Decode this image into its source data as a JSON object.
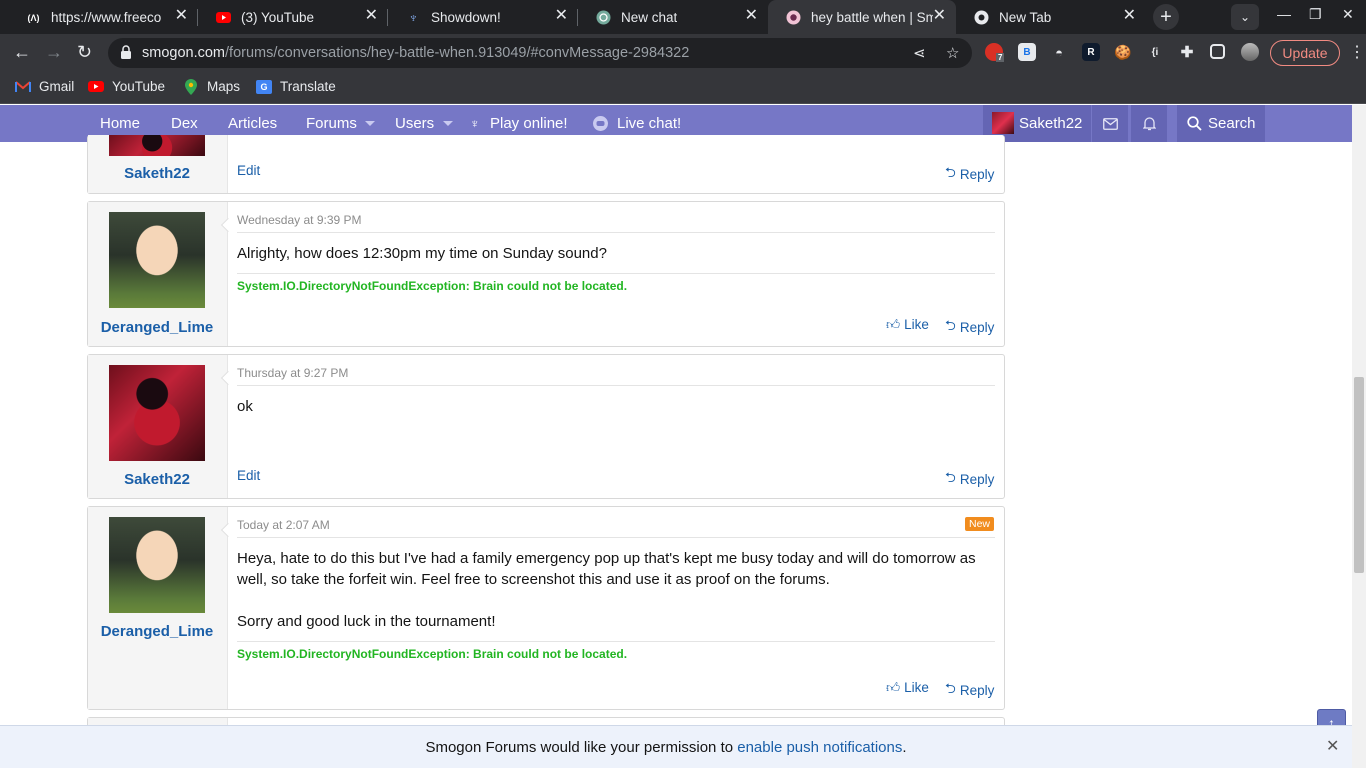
{
  "browser": {
    "tabs": [
      {
        "title": "https://www.freeco",
        "favicon": "freecodecamp-icon"
      },
      {
        "title": "(3) YouTube",
        "favicon": "youtube-icon"
      },
      {
        "title": "Showdown!",
        "favicon": "showdown-icon"
      },
      {
        "title": "New chat",
        "favicon": "chatgpt-icon"
      },
      {
        "title": "hey battle when | Sm",
        "favicon": "smogon-icon",
        "active": true
      },
      {
        "title": "New Tab",
        "favicon": "chrome-icon"
      }
    ],
    "url_host": "smogon.com",
    "url_path": "/forums/conversations/hey-battle-when.913049/#convMessage-2984322",
    "extension_badge": "7",
    "extension_b": "B",
    "extension_r": "R",
    "extension_braces": "{i",
    "update_label": "Update",
    "bookmarks": [
      "Gmail",
      "YouTube",
      "Maps",
      "Translate"
    ]
  },
  "site_nav": {
    "items": [
      "Home",
      "Dex",
      "Articles",
      "Forums",
      "Users",
      "Play online!",
      "Live chat!"
    ],
    "username": "Saketh22",
    "search_label": "Search"
  },
  "messages": [
    {
      "author": "Saketh22",
      "actions": [
        "Edit",
        "Reply"
      ]
    },
    {
      "author": "Deranged_Lime",
      "date": "Wednesday at 9:39 PM",
      "body": "Alrighty, how does 12:30pm my time on Sunday sound?",
      "signature": "System.IO.DirectoryNotFoundException: Brain could not be located.",
      "actions": [
        "Like",
        "Reply"
      ]
    },
    {
      "author": "Saketh22",
      "date": "Thursday at 9:27 PM",
      "body": "ok",
      "actions": [
        "Edit",
        "Reply"
      ]
    },
    {
      "author": "Deranged_Lime",
      "date": "Today at 2:07 AM",
      "badge": "New",
      "body_lines": [
        "Heya, hate to do this but I've had a family emergency pop up that's kept me busy today and will do tomorrow as",
        "well, so take the forfeit win. Feel free to screenshot this and use it as proof on the forums.",
        "Sorry and good luck in the tournament!"
      ],
      "signature": "System.IO.DirectoryNotFoundException: Brain could not be located.",
      "actions": [
        "Like",
        "Reply"
      ]
    }
  ],
  "notification": {
    "prefix": "Smogon Forums would like your permission to ",
    "link": "enable push notifications",
    "suffix": "."
  }
}
